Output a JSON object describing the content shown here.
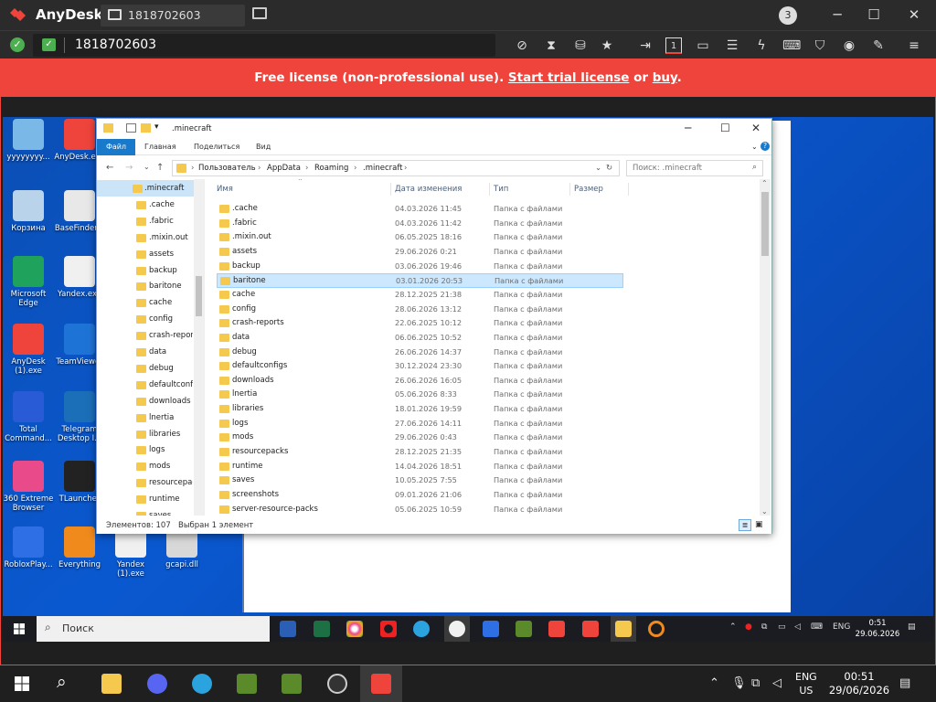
{
  "anydesk": {
    "app_name": "AnyDesk",
    "tab_label": "1818702603",
    "address": "1818702603",
    "badge": "3"
  },
  "banner": {
    "prefix": "Free license (non-professional use). ",
    "trial_link": "Start trial license",
    "middle": " or ",
    "buy_link": "buy",
    "suffix": "."
  },
  "desktop_icons": [
    {
      "label": "yyyyyyyy...",
      "color": "#7ab8e8"
    },
    {
      "label": "AnyDesk.exe",
      "color": "#ef443b"
    },
    {
      "label": "Корзина",
      "color": "#b9d4ea"
    },
    {
      "label": "BaseFinder...",
      "color": "#e8e8e8"
    },
    {
      "label": "Microsoft Edge",
      "color": "#1fa35c"
    },
    {
      "label": "Yandex.exe",
      "color": "#f0f0f0"
    },
    {
      "label": "AnyDesk (1).exe",
      "color": "#ef443b"
    },
    {
      "label": "TeamViewer",
      "color": "#1e74d6"
    },
    {
      "label": "Total Command...",
      "color": "#2a5bd7"
    },
    {
      "label": "Telegram Desktop I...",
      "color": "#1b6fb8"
    },
    {
      "label": "360 Extreme Browser",
      "color": "#e84a8a"
    },
    {
      "label": "TLauncher",
      "color": "#222"
    },
    {
      "label": "RobloxPlay...",
      "color": "#2e6fe6"
    },
    {
      "label": "Everything",
      "color": "#f08a1d"
    },
    {
      "label": "Yandex (1).exe",
      "color": "#f0f0f0"
    },
    {
      "label": "gcapi.dll",
      "color": "#d8d8d8"
    }
  ],
  "explorer": {
    "title": ".minecraft",
    "ribbon": {
      "file": "Файл",
      "home": "Главная",
      "share": "Поделиться",
      "view": "Вид"
    },
    "breadcrumb": [
      "Пользователь",
      "AppData",
      "Roaming",
      ".minecraft"
    ],
    "search_placeholder": "Поиск: .minecraft",
    "columns": {
      "name": "Имя",
      "date": "Дата изменения",
      "type": "Тип",
      "size": "Размер"
    },
    "nav_items": [
      ".minecraft",
      ".cache",
      ".fabric",
      ".mixin.out",
      "assets",
      "backup",
      "baritone",
      "cache",
      "config",
      "crash-repor",
      "data",
      "debug",
      "defaultconf",
      "downloads",
      "lnertia",
      "libraries",
      "logs",
      "mods",
      "resourcepac",
      "runtime",
      "saves"
    ],
    "files": [
      {
        "name": ".cache",
        "date": "04.03.2026 11:45",
        "type": "Папка с файлами"
      },
      {
        "name": ".fabric",
        "date": "04.03.2026 11:42",
        "type": "Папка с файлами"
      },
      {
        "name": ".mixin.out",
        "date": "06.05.2025 18:16",
        "type": "Папка с файлами"
      },
      {
        "name": "assets",
        "date": "29.06.2026 0:21",
        "type": "Папка с файлами"
      },
      {
        "name": "backup",
        "date": "03.06.2026 19:46",
        "type": "Папка с файлами"
      },
      {
        "name": "baritone",
        "date": "03.01.2026 20:53",
        "type": "Папка с файлами"
      },
      {
        "name": "cache",
        "date": "28.12.2025 21:38",
        "type": "Папка с файлами"
      },
      {
        "name": "config",
        "date": "28.06.2026 13:12",
        "type": "Папка с файлами"
      },
      {
        "name": "crash-reports",
        "date": "22.06.2025 10:12",
        "type": "Папка с файлами"
      },
      {
        "name": "data",
        "date": "06.06.2025 10:52",
        "type": "Папка с файлами"
      },
      {
        "name": "debug",
        "date": "26.06.2026 14:37",
        "type": "Папка с файлами"
      },
      {
        "name": "defaultconfigs",
        "date": "30.12.2024 23:30",
        "type": "Папка с файлами"
      },
      {
        "name": "downloads",
        "date": "26.06.2026 16:05",
        "type": "Папка с файлами"
      },
      {
        "name": "lnertia",
        "date": "05.06.2026 8:33",
        "type": "Папка с файлами"
      },
      {
        "name": "libraries",
        "date": "18.01.2026 19:59",
        "type": "Папка с файлами"
      },
      {
        "name": "logs",
        "date": "27.06.2026 14:11",
        "type": "Папка с файлами"
      },
      {
        "name": "mods",
        "date": "29.06.2026 0:43",
        "type": "Папка с файлами"
      },
      {
        "name": "resourcepacks",
        "date": "28.12.2025 21:35",
        "type": "Папка с файлами"
      },
      {
        "name": "runtime",
        "date": "14.04.2026 18:51",
        "type": "Папка с файлами"
      },
      {
        "name": "saves",
        "date": "10.05.2025 7:55",
        "type": "Папка с файлами"
      },
      {
        "name": "screenshots",
        "date": "09.01.2026 21:06",
        "type": "Папка с файлами"
      },
      {
        "name": "server-resource-packs",
        "date": "05.06.2025 10:59",
        "type": "Папка с файлами"
      }
    ],
    "selected_file": "baritone",
    "status_count": "Элементов: 107",
    "status_selected": "Выбран 1 элемент"
  },
  "remote_taskbar": {
    "search_label": "Поиск",
    "lang": "ENG",
    "time": "0:51",
    "date": "29.06.2026"
  },
  "local_taskbar": {
    "lang_top": "ENG",
    "lang_bottom": "US",
    "time": "00:51",
    "date": "29/06/2026"
  },
  "colors": {
    "anydesk_red": "#ef443b",
    "selection": "#cce8ff",
    "folder": "#f5c94e"
  }
}
